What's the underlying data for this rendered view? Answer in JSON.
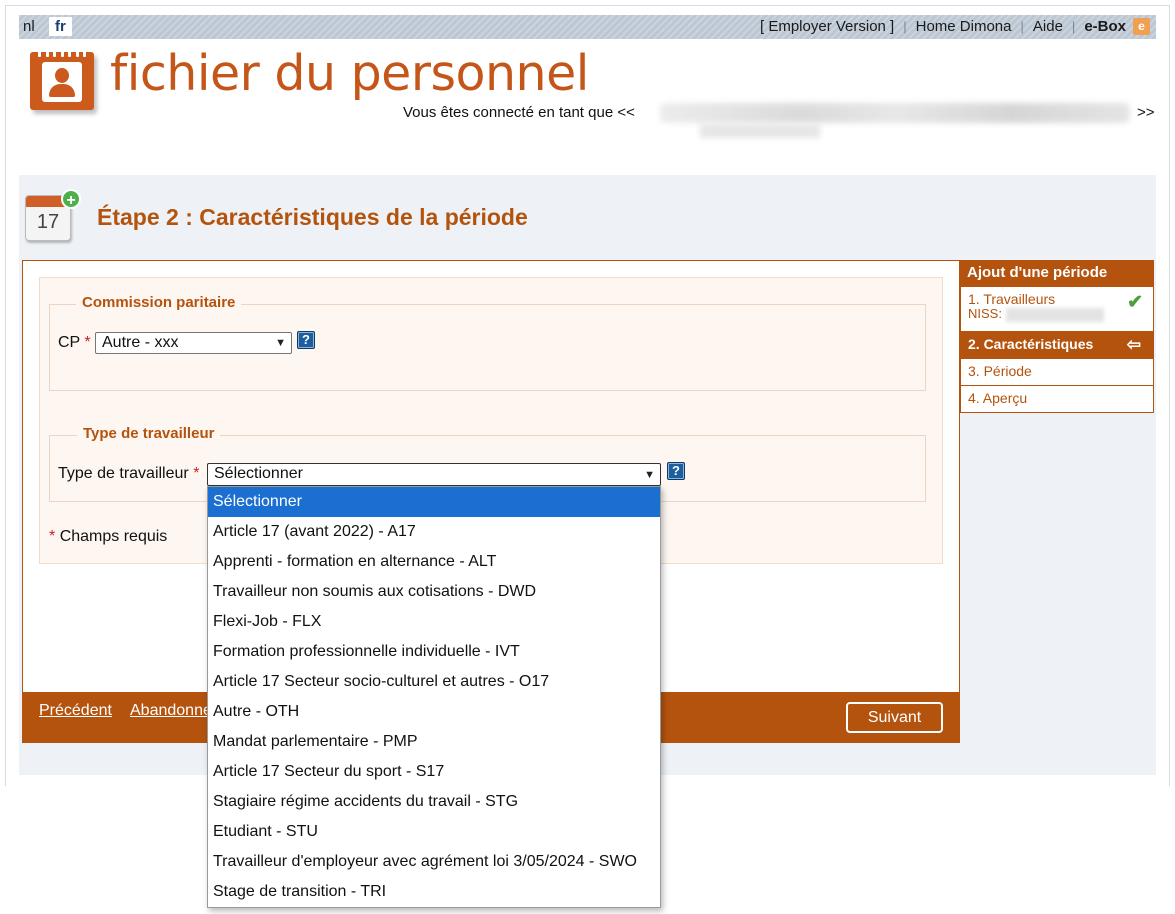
{
  "topbar": {
    "lang_nl": "nl",
    "lang_fr": "fr",
    "employer_version": "[ Employer Version ]",
    "home_dimona": "Home Dimona",
    "aide": "Aide",
    "ebox": "e-Box",
    "ebox_icon_glyph": "e",
    "separator": "|"
  },
  "header": {
    "app_title": "fichier du personnel",
    "connected_prefix": "Vous êtes connecté en tant que <<",
    "connected_suffix": ">>"
  },
  "step": {
    "icon_number": "17",
    "title": "Étape 2 : Caractéristiques de la période"
  },
  "form": {
    "section_cp": "Commission paritaire",
    "cp_label": "CP",
    "required_star": "*",
    "cp_value": "Autre - xxx",
    "help_glyph": "?",
    "section_worker": "Type de travailleur",
    "worker_label": "Type de travailleur",
    "worker_value": "Sélectionner",
    "required_note": "Champs requis"
  },
  "footer": {
    "previous": "Précédent",
    "abandon": "Abandonner",
    "next": "Suivant"
  },
  "sidebar": {
    "title": "Ajout d'une période",
    "items": [
      {
        "label": "1. Travailleurs",
        "sub": "NISS:"
      },
      {
        "label": "2. Caractéristiques"
      },
      {
        "label": "3. Période"
      },
      {
        "label": "4. Aperçu"
      }
    ]
  },
  "dropdown": {
    "options": [
      "Sélectionner",
      "Article 17 (avant 2022) - A17",
      "Apprenti - formation en alternance - ALT",
      "Travailleur non soumis aux cotisations - DWD",
      "Flexi-Job - FLX",
      "Formation professionnelle individuelle - IVT",
      "Article 17 Secteur socio-culturel et autres - O17",
      "Autre - OTH",
      "Mandat parlementaire - PMP",
      "Article 17 Secteur du sport - S17",
      "Stagiaire régime accidents du travail - STG",
      "Etudiant - STU",
      "Travailleur d'employeur avec agrément loi 3/05/2024 - SWO",
      "Stage de transition - TRI"
    ]
  },
  "icons": {
    "ebox": "ebox-icon",
    "logo": "person-card-icon",
    "step": "calendar-add-icon",
    "help": "help-icon",
    "check": "checkmark-icon",
    "current": "arrow-left-icon",
    "select": "chevron-down-icon"
  },
  "colors": {
    "brand": "#b4530e",
    "topbar": "#bcc7d4",
    "selection": "#1a6fd1",
    "check": "#4aa03b"
  }
}
